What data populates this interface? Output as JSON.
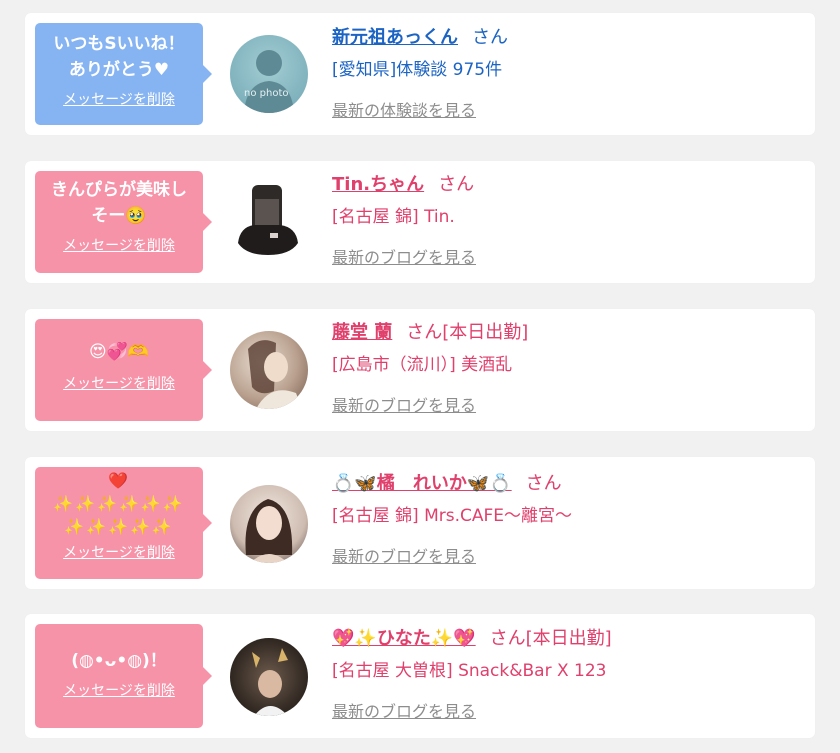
{
  "cards": [
    {
      "message": "いつもSいいね！\nありがとう♥",
      "delete_label": "メッセージを削除",
      "name": "新元祖あっくん",
      "honorific": "さん",
      "subtitle": "[愛知県]体験談 975件",
      "link_label": "最新の体験談を見る",
      "avatar_text": "no photo",
      "theme_color": "#1c64c4",
      "bubble_color": "#86b4f2"
    },
    {
      "message": "きんぴらが美味し\nそー🥹",
      "delete_label": "メッセージを削除",
      "name": "Tin.ちゃん",
      "honorific": "さん",
      "subtitle": "[名古屋 錦] Tin.",
      "link_label": "最新のブログを見る",
      "theme_color": "#e0406c",
      "bubble_color": "#f693a8"
    },
    {
      "message": "😍💞🫶",
      "delete_label": "メッセージを削除",
      "name": "藤堂 蘭",
      "honorific": "さん[本日出勤]",
      "subtitle": "[広島市（流川）] 美酒乱",
      "link_label": "最新のブログを見る",
      "theme_color": "#e0406c",
      "bubble_color": "#f693a8"
    },
    {
      "message": "❤️\n✨✨✨✨✨✨\n✨✨✨✨✨",
      "delete_label": "メッセージを削除",
      "name": "💍🦋橘　れいか🦋💍",
      "honorific": "さん",
      "subtitle": "[名古屋 錦] Mrs.CAFE～離宮～",
      "link_label": "最新のブログを見る",
      "theme_color": "#e0406c",
      "bubble_color": "#f693a8"
    },
    {
      "message": "(◍•ᴗ•◍)！",
      "delete_label": "メッセージを削除",
      "name": "💖✨ひなた✨💖",
      "honorific": "さん[本日出勤]",
      "subtitle": "[名古屋 大曽根] Snack&Bar X 123",
      "link_label": "最新のブログを見る",
      "theme_color": "#e0406c",
      "bubble_color": "#f693a8"
    }
  ]
}
